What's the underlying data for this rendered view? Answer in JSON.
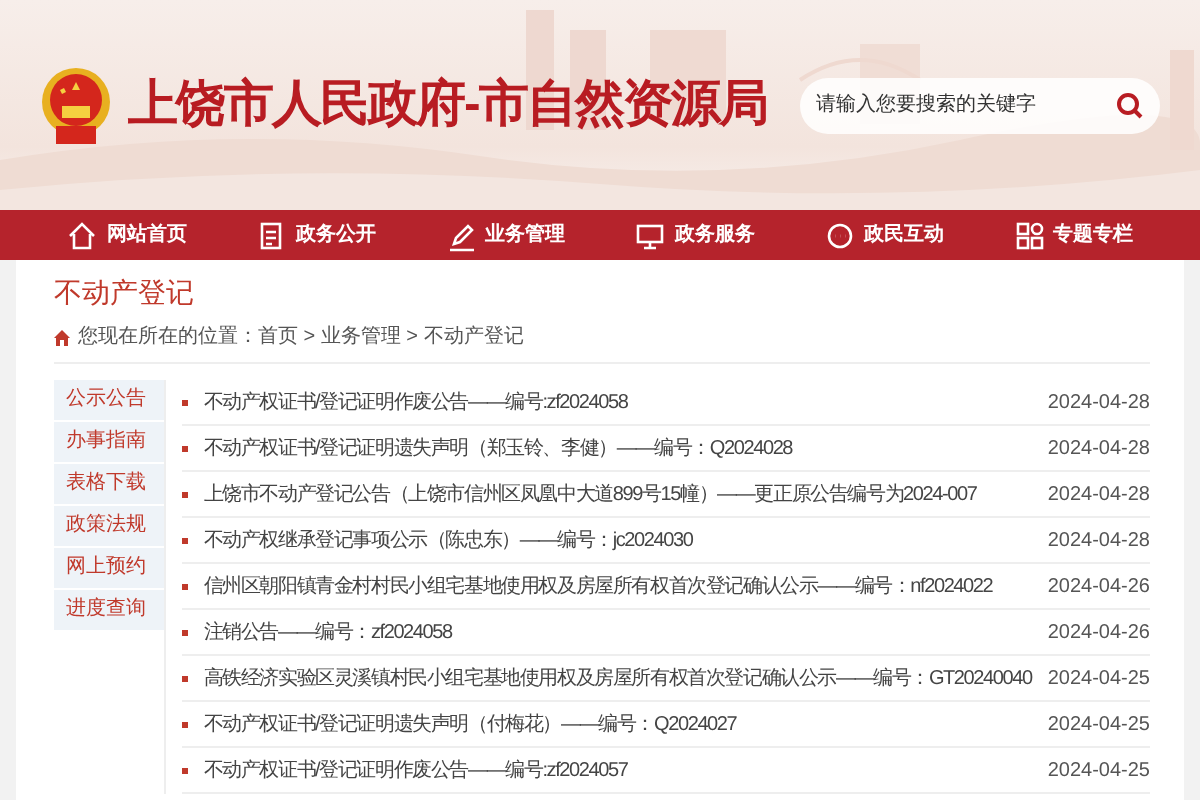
{
  "header": {
    "title": "上饶市人民政府-市自然资源局",
    "search": {
      "placeholder": "请输入您要搜索的关键字"
    }
  },
  "nav": [
    {
      "label": "网站首页",
      "kind": "home"
    },
    {
      "label": "政务公开",
      "kind": "document"
    },
    {
      "label": "业务管理",
      "kind": "pen"
    },
    {
      "label": "政务服务",
      "kind": "monitor"
    },
    {
      "label": "政民互动",
      "kind": "chat"
    },
    {
      "label": "专题专栏",
      "kind": "grid"
    }
  ],
  "section_title": "不动产登记",
  "breadcrumb": "您现在所在的位置：首页 > 业务管理 > 不动产登记",
  "sidebar": {
    "items": [
      "公示公告",
      "办事指南",
      "表格下载",
      "政策法规",
      "网上预约",
      "进度查询"
    ]
  },
  "list": [
    {
      "title": "不动产权证书/登记证明作废公告——编号:zf2024058",
      "date": "2024-04-28"
    },
    {
      "title": "不动产权证书/登记证明遗失声明（郑玉铃、李健）——编号：Q2024028",
      "date": "2024-04-28"
    },
    {
      "title": "上饶市不动产登记公告（上饶市信州区凤凰中大道899号15幢）——更正原公告编号为2024-007",
      "date": "2024-04-28"
    },
    {
      "title": "不动产权继承登记事项公示（陈忠东）——编号：jc2024030",
      "date": "2024-04-28"
    },
    {
      "title": "信州区朝阳镇青金村村民小组宅基地使用权及房屋所有权首次登记确认公示——编号：nf2024022",
      "date": "2024-04-26"
    },
    {
      "title": "注销公告——编号：zf2024058",
      "date": "2024-04-26"
    },
    {
      "title": "高铁经济实验区灵溪镇村民小组宅基地使用权及房屋所有权首次登记确认公示——编号：GT20240040",
      "date": "2024-04-25"
    },
    {
      "title": "不动产权证书/登记证明遗失声明（付梅花）——编号：Q2024027",
      "date": "2024-04-25"
    },
    {
      "title": "不动产权证书/登记证明作废公告——编号:zf2024057",
      "date": "2024-04-25"
    }
  ]
}
